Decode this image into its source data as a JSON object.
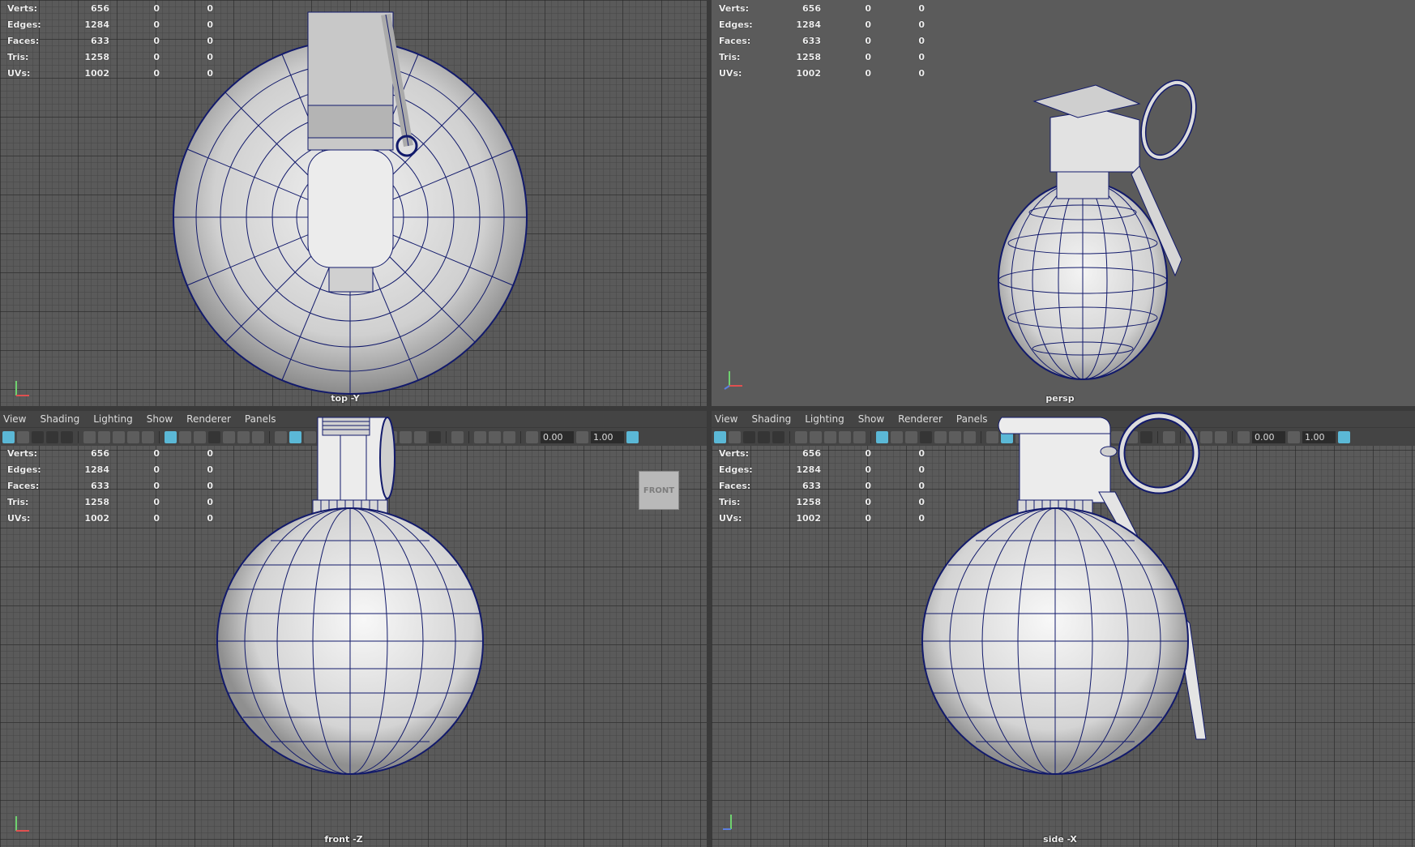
{
  "stats": {
    "rows": [
      {
        "label": "Verts:",
        "v1": "656",
        "v2": "0",
        "v3": "0"
      },
      {
        "label": "Edges:",
        "v1": "1284",
        "v2": "0",
        "v3": "0"
      },
      {
        "label": "Faces:",
        "v1": "633",
        "v2": "0",
        "v3": "0"
      },
      {
        "label": "Tris:",
        "v1": "1258",
        "v2": "0",
        "v3": "0"
      },
      {
        "label": "UVs:",
        "v1": "1002",
        "v2": "0",
        "v3": "0"
      }
    ]
  },
  "menu": [
    "View",
    "Shading",
    "Lighting",
    "Show",
    "Renderer",
    "Panels"
  ],
  "toolbar": {
    "field1": "0.00",
    "field2": "1.00"
  },
  "viewports": {
    "top": {
      "camera": "top -Y"
    },
    "persp": {
      "camera": "persp"
    },
    "front": {
      "camera": "front -Z",
      "viewcube": "FRONT"
    },
    "side": {
      "camera": "side -X"
    }
  },
  "colors": {
    "wire": "#121a6b",
    "surface": "#d8d8d8",
    "ui_accent": "#5bb8d6"
  },
  "icons": [
    "select-icon",
    "camera-icon",
    "grid-icon",
    "wireframe-icon",
    "smooth-shade-icon",
    "light-icon",
    "isolate-icon",
    "xray-icon",
    "exposure-icon",
    "gamma-icon",
    "color-management-icon"
  ]
}
